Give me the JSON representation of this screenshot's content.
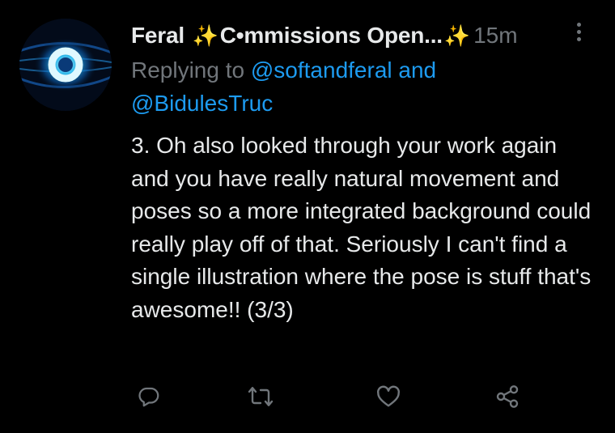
{
  "tweet": {
    "display_name_part1": "Feral ",
    "display_name_part2": "C•mmissions Open...",
    "timestamp": "15m",
    "replying_to_label": "Replying to ",
    "mention_1": "@softandferal",
    "and_label": " and",
    "mention_2": "@BidulesTruc",
    "body": "3. Oh also looked through your work again and you have really natural movement and poses so a more integrated background could really play off of that. Seriously I can't find a single illustration where the pose is stuff that's awesome!! (3/3)"
  },
  "icons": {
    "sparkle": "sparkles-icon",
    "more": "more-options-icon",
    "reply": "reply-icon",
    "retweet": "retweet-icon",
    "like": "heart-icon",
    "share": "share-icon"
  },
  "colors": {
    "background": "#000000",
    "text": "#e7e9ea",
    "secondary": "#71767b",
    "link": "#1d9bf0",
    "sparkle": "#f4c430"
  }
}
